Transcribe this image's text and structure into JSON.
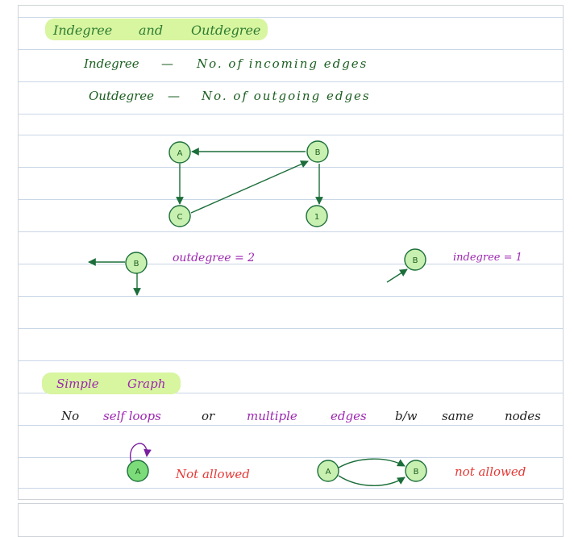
{
  "colors": {
    "heading": "#2e7d32",
    "body": "#1b5e20",
    "accent": "#9c27b0",
    "warn": "#e53935",
    "highlight": "#d8f5a0",
    "node_fill": "#c8f0b0",
    "node_fill_dark": "#7ddc7a",
    "edge": "#1b6e3a"
  },
  "section1": {
    "title_left": "Indegree",
    "title_mid": "and",
    "title_right": "Outdegree",
    "def1_term": "Indegree",
    "def1_dash": "—",
    "def1_text": "No. of incoming edges",
    "def2_term": "Outdegree",
    "def2_dash": "—",
    "def2_text": "No. of outgoing edges"
  },
  "graph1": {
    "nodes": [
      "A",
      "B",
      "C",
      "1"
    ]
  },
  "examples": {
    "out_node": "B",
    "out_label": "outdegree = 2",
    "in_node": "B",
    "in_label": "indegree = 1"
  },
  "section2": {
    "title_left": "Simple",
    "title_right": "Graph",
    "line_words": [
      "No",
      "self loops",
      "or",
      "multiple",
      "edges",
      "b/w",
      "same",
      "nodes"
    ],
    "loop_node": "A",
    "loop_note": "Not allowed",
    "multi_node_a": "A",
    "multi_node_b": "B",
    "multi_note": "not allowed"
  }
}
